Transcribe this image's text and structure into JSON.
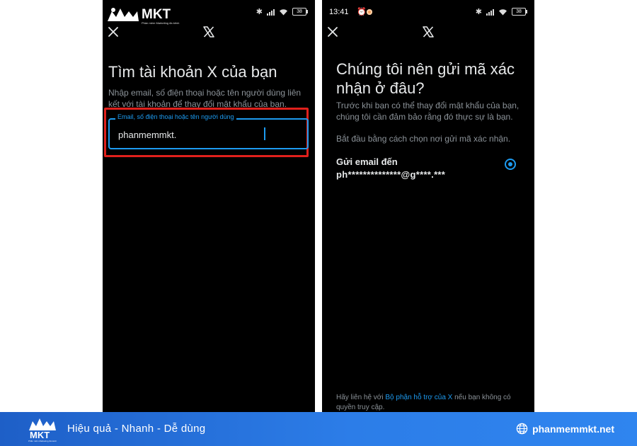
{
  "brand": {
    "logo_text": "MKT",
    "logo_subtext": "Phần mềm Marketing đa kênh",
    "tagline": "Hiệu quả - Nhanh - Dễ dùng",
    "website": "phanmemmkt.net",
    "colors": {
      "banner": "#2c7de8",
      "highlight": "#e0201c"
    }
  },
  "left_screen": {
    "status": {
      "battery": "38"
    },
    "heading": "Tìm tài khoản X của bạn",
    "description": "Nhập email, số điện thoại hoặc tên người dùng liên kết với tài khoản để thay đổi mật khẩu của bạn.",
    "input": {
      "label": "Email, số điện thoại hoặc tên người dùng",
      "value": "phanmemmkt."
    }
  },
  "right_screen": {
    "status": {
      "time": "13:41",
      "battery": "38"
    },
    "heading": "Chúng tôi nên gửi mã xác nhận ở đâu?",
    "description": "Trước khi bạn có thể thay đổi mật khẩu của bạn, chúng tôi cần đảm bảo rằng đó thực sự là bạn.",
    "instruction": "Bắt đầu bằng cách chọn nơi gửi mã xác nhận.",
    "option": {
      "title": "Gửi email đến",
      "value": "ph**************@g****.***",
      "selected": true
    },
    "footer": {
      "prefix": "Hãy liên hệ với ",
      "link": "Bộ phận hỗ trợ của X",
      "suffix": " nếu bạn không có quyền truy cập."
    }
  },
  "icons": {
    "close": "close-icon",
    "x_logo": "x-logo-icon",
    "bluetooth": "bluetooth-icon",
    "signal": "signal-icon",
    "wifi": "wifi-icon",
    "battery": "battery-icon",
    "globe": "globe-icon"
  },
  "accent": "#1d9bf0"
}
